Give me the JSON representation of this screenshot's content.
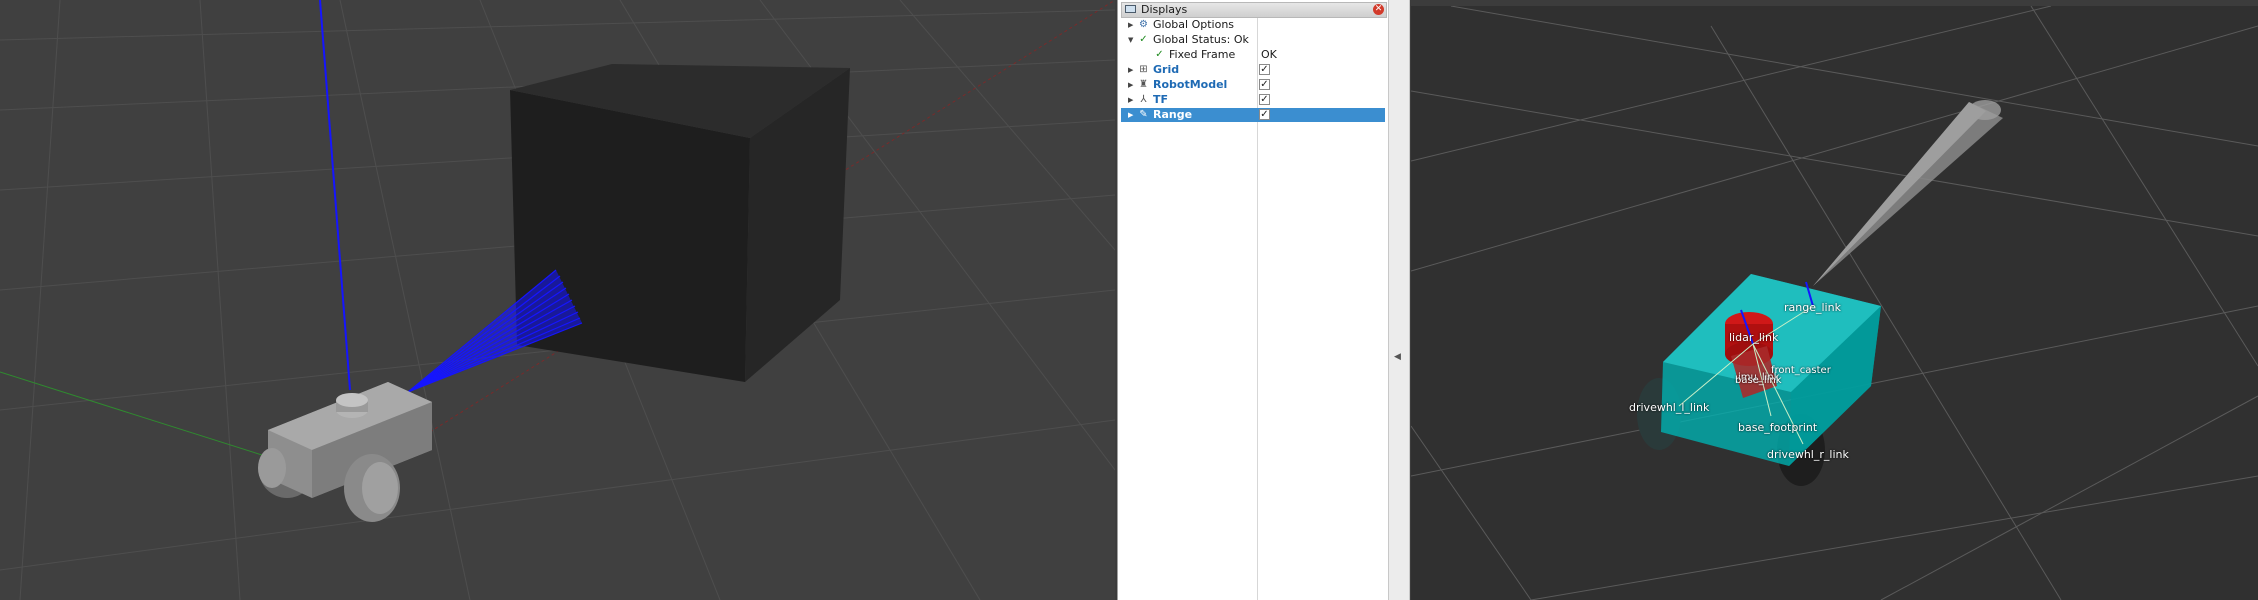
{
  "displays_panel": {
    "title": "Displays",
    "rows": [
      {
        "label": "Global Options",
        "icon": "gear-icon"
      },
      {
        "label": "Global Status: Ok",
        "icon": "checkmark-icon"
      },
      {
        "label": "Fixed Frame",
        "value": "OK",
        "icon": "checkmark-icon"
      },
      {
        "label": "Grid",
        "icon": "grid-icon",
        "checked": true
      },
      {
        "label": "RobotModel",
        "icon": "robot-model-icon",
        "checked": true
      },
      {
        "label": "TF",
        "icon": "tf-icon",
        "checked": true
      },
      {
        "label": "Range",
        "icon": "range-icon",
        "checked": true,
        "selected": true
      }
    ]
  },
  "rviz_view": {
    "frame_labels": {
      "range_link": "range_link",
      "lidar_link": "lidar_link",
      "base_link": "base_link",
      "imu_link": "imu_link",
      "front_caster": "front_caster",
      "drivewhl_l_link": "drivewhl_l_link",
      "base_footprint": "base_footprint",
      "drivewhl_r_link": "drivewhl_r_link"
    }
  },
  "colors": {
    "selection": "#3b8ed0",
    "display_label": "#1e6ab4",
    "laser_rays": "#1515ff",
    "robot_body": "#00b4b4",
    "lidar": "#c01010"
  }
}
